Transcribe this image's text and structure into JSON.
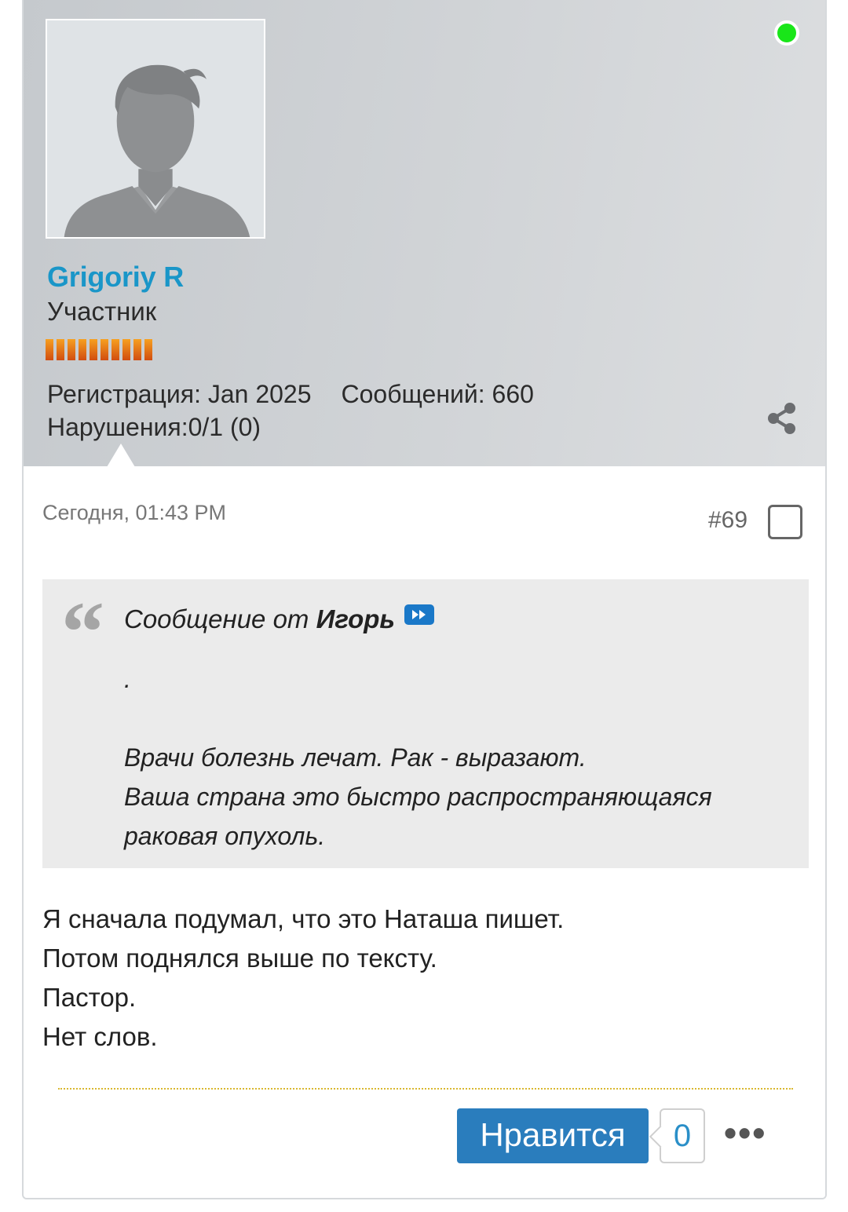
{
  "user": {
    "name": "Grigoriy R",
    "title": "Участник",
    "registration": "Регистрация: Jan 2025",
    "messages": "Сообщений: 660",
    "violations": "Нарушения:0/1 (0)",
    "online_color": "#19e619",
    "reputation_segments": 10
  },
  "post": {
    "date": "Сегодня, 01:43 PM",
    "number": "#69",
    "quote": {
      "prefix": "Сообщение от",
      "author": "Игорь",
      "text": ".\n\nВрачи болезнь лечат. Рак - выразают.\nВаша страна это быстро распространяющаяся\nраковая опухоль."
    },
    "message": "Я сначала подумал, что это Наташа пишет.\nПотом поднялся выше по тексту.\nПастор.\nНет слов.",
    "like_label": "Нравится",
    "like_count": "0",
    "more_label": "•••"
  },
  "colors": {
    "username": "#1a96c8",
    "like_button": "#2a7dbd",
    "separator": "#d9b830"
  },
  "icons": [
    "avatar-placeholder-icon",
    "online-status-icon",
    "share-icon",
    "checkbox-icon",
    "quote-mark-icon",
    "view-post-icon",
    "more-options-icon"
  ]
}
